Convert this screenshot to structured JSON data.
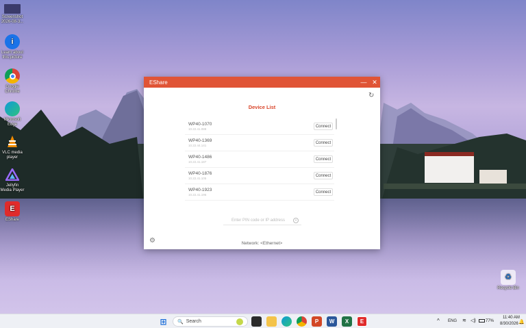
{
  "desktop": {
    "icons": [
      {
        "label": "Screenshot 2026-08-3...",
        "icon": "image-thumbnail-icon",
        "color": "#3b3b6b"
      },
      {
        "label": "Learn about this picture",
        "icon": "info-icon",
        "color": "#1a73e8"
      },
      {
        "label": "Google Chrome",
        "icon": "chrome-icon",
        "color": "#db4437"
      },
      {
        "label": "Microsoft Edge",
        "icon": "edge-icon",
        "color": "#0f9bd7"
      },
      {
        "label": "VLC media player",
        "icon": "vlc-cone-icon",
        "color": "#f08c00"
      },
      {
        "label": "Jellyfin Media Player",
        "icon": "jellyfin-icon",
        "color": "#6b3fc0"
      },
      {
        "label": "EShare",
        "icon": "eshare-icon",
        "color": "#e02b2b"
      }
    ],
    "recycle_bin": {
      "label": "Recycle Bin",
      "icon": "recycle-bin-icon"
    }
  },
  "window": {
    "title": "EShare",
    "minimize_glyph": "—",
    "close_glyph": "✕",
    "refresh_glyph": "↻",
    "device_list_title": "Device List",
    "devices": [
      {
        "name": "WP40-1070",
        "ip": "10.22.41.088",
        "connect_label": "Connect"
      },
      {
        "name": "WP40-1369",
        "ip": "10.22.44.141",
        "connect_label": "Connect"
      },
      {
        "name": "WP40-1486",
        "ip": "10.22.41.187",
        "connect_label": "Connect"
      },
      {
        "name": "WP40-1876",
        "ip": "10.22.41.105",
        "connect_label": "Connect"
      },
      {
        "name": "WP40-1923",
        "ip": "10.22.41.196",
        "connect_label": "Connect"
      }
    ],
    "pin_placeholder": "Enter PIN code or IP address",
    "pin_go_glyph": "»",
    "settings_glyph": "⚙",
    "network_label": "Network: <Ethernet>",
    "accent": "#e05436"
  },
  "taskbar": {
    "search_label": "Search",
    "search_glyph": "🔍",
    "start_glyph": "⊞",
    "tray": {
      "chevron": "^",
      "language": "ENG",
      "battery": "77%",
      "time": "11:40 AM",
      "date": "8/30/2026"
    }
  }
}
